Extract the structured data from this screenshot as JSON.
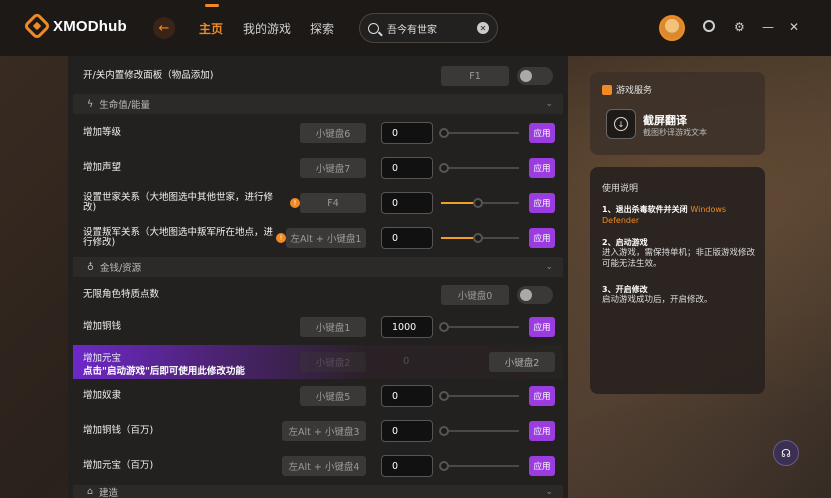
{
  "app": {
    "name": "XMODhub"
  },
  "nav": {
    "back_icon": "back-arrow-icon",
    "home": "主页",
    "my_games": "我的游戏",
    "explore": "探索"
  },
  "search": {
    "value": "吾今有世家",
    "icon": "search-icon"
  },
  "window": {
    "settings_icon": "settings-icon",
    "minimize": "—",
    "close": "✕"
  },
  "colors": {
    "accent": "#f08a24",
    "apply": "#9a3ce0",
    "panel": "#232120"
  },
  "rows": {
    "toggle_panel": {
      "label": "开/关内置修改面板（物品添加)",
      "key": "F1"
    },
    "level": {
      "label": "增加等级",
      "key": "小键盘6",
      "value": "0",
      "apply": "应用"
    },
    "fame": {
      "label": "增加声望",
      "key": "小键盘7",
      "value": "0",
      "apply": "应用"
    },
    "family_rel": {
      "label": "设置世家关系（大地图选中其他世家，进行修改)",
      "key": "F4",
      "value": "0",
      "apply": "应用"
    },
    "rebel_rel": {
      "label": "设置叛军关系（大地图选中叛军所在地点，进行修改)",
      "key": "左Alt + 小键盘1",
      "value": "0",
      "apply": "应用"
    },
    "inf_points": {
      "label": "无限角色特质点数",
      "key": "小键盘0"
    },
    "money": {
      "label": "增加铜钱",
      "key": "小键盘1",
      "value": "1000",
      "apply": "应用"
    },
    "yuanbao": {
      "label": "增加元宝",
      "tip": "点击\"启动游戏\"后即可使用此修改功能",
      "key_faded": "小键盘2",
      "value_faded": "0",
      "key": "小键盘2"
    },
    "slaves": {
      "label": "增加奴隶",
      "key": "小键盘5",
      "value": "0",
      "apply": "应用"
    },
    "money_m": {
      "label": "增加铜钱（百万)",
      "key": "左Alt + 小键盘3",
      "value": "0",
      "apply": "应用"
    },
    "yuanbao_m": {
      "label": "增加元宝（百万)",
      "key": "左Alt + 小键盘4",
      "value": "0",
      "apply": "应用"
    }
  },
  "sections": {
    "health": "生命值/能量",
    "money": "金钱/资源",
    "build": "建造"
  },
  "service": {
    "title": "游戏服务",
    "name": "截屏翻译",
    "desc": "截图秒译游戏文本"
  },
  "help": {
    "title": "使用说明",
    "item1_title": "1、退出杀毒软件并关闭",
    "item1_highlight": "Windows Defender",
    "item2_title": "2、启动游戏",
    "item2_text": "进入游戏，需保持单机；非正版游戏修改可能无法生效。",
    "item3_title": "3、开启修改",
    "item3_text": "启动游戏成功后，开启修改。"
  }
}
